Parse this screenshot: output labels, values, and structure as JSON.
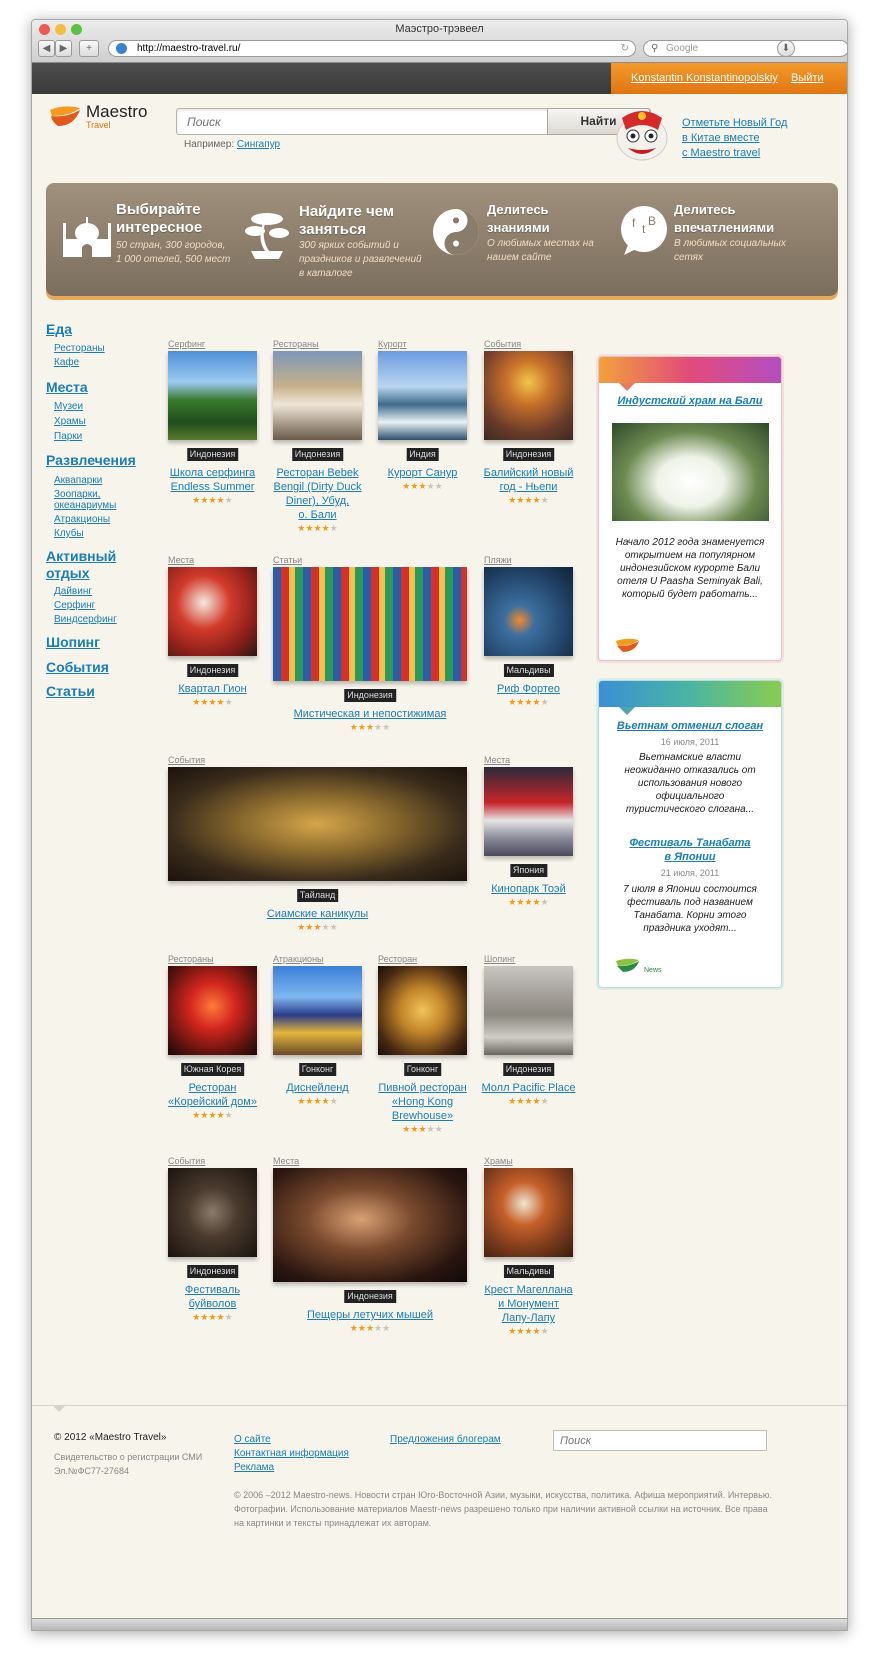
{
  "window": {
    "title": "Маэстро-трэвеел",
    "url": "http://maestro-travel.ru/",
    "search_placeholder": "Google"
  },
  "userbar": {
    "username": "Konstantin Konstantinopolskiy",
    "logout": "Выйти"
  },
  "logo": {
    "name": "Maestro",
    "sub": "Travel"
  },
  "search": {
    "placeholder": "Поиск",
    "button": "Найти",
    "example_label": "Например:",
    "example_link": "Сингапур"
  },
  "promo": {
    "line1": "Отметьте Новый Год",
    "line2": "в Китае вместе",
    "line3": "с Maestro travel"
  },
  "features": [
    {
      "title1": "Выбирайте",
      "title2": "интересное",
      "text1": "50 стран, 300 городов,",
      "text2": "1 000 отелей, 500 мест",
      "icon": "taj-mahal-icon"
    },
    {
      "title1": "Найдите чем",
      "title2": "заняться",
      "text1": "300 ярких событий и",
      "text2": "праздников и развлечений",
      "text3": "в каталоге",
      "icon": "bonsai-icon"
    },
    {
      "title1": "Делитесь",
      "title2": "знаниями",
      "text1": "О любимых местах на",
      "text2": "нашем сайте",
      "icon": "yin-yang-icon"
    },
    {
      "title1": "Делитесь",
      "title2": "впечатлениями",
      "text1": "В любимых социальных",
      "text2": "сетях",
      "icon": "social-bubble-icon"
    }
  ],
  "nav": {
    "food": "Еда",
    "food_items": [
      "Рестораны",
      "Кафе"
    ],
    "places": "Места",
    "places_items": [
      "Музеи",
      "Храмы",
      "Парки"
    ],
    "fun": "Развлечения",
    "fun_items": [
      "Аквапарки",
      "Зоопарки,",
      "океанариумы",
      "Атракционы",
      "Клубы"
    ],
    "active1": "Активный",
    "active2": "отдых",
    "active_items": [
      "Дайвинг",
      "Серфинг",
      "Виндсерфинг"
    ],
    "shopping": "Шопинг",
    "events": "События",
    "articles": "Статьи"
  },
  "items": [
    {
      "cat": "Серфинг",
      "tag": "Индонезия",
      "t1": "Школа серфинга",
      "t2": "Endless Summer",
      "rating": 4
    },
    {
      "cat": "Рестораны",
      "tag": "Индонезия",
      "t1": "Ресторан Bebek",
      "t2": "Bengil (Dirty Duck",
      "t3": "Diner), Убуд,",
      "t4": "о. Бали",
      "rating": 4
    },
    {
      "cat": "Курорт",
      "tag": "Индия",
      "t1": "Курорт Санур",
      "rating": 3
    },
    {
      "cat": "События",
      "tag": "Индонезия",
      "t1": "Балийский новый",
      "t2": "год - Ньепи",
      "rating": 4
    },
    {
      "cat": "Места",
      "tag": "Индонезия",
      "t1": "Квартал Гион",
      "rating": 4
    },
    {
      "cat": "Статьи",
      "tag": "Индонезия",
      "t1": "Мистическая и непостижимая",
      "rating": 3
    },
    {
      "cat": "Пляжи",
      "tag": "Мальдивы",
      "t1": "Риф Фортео",
      "rating": 4
    },
    {
      "cat": "События",
      "tag": "Тайланд",
      "t1": "Сиамские каникулы",
      "rating": 3
    },
    {
      "cat": "Места",
      "tag": "Япония",
      "t1": "Кинопарк Тоэй",
      "rating": 4
    },
    {
      "cat": "Рестораны",
      "tag": "Южная Корея",
      "t1": "Ресторан",
      "t2": "«Корейский дом»",
      "rating": 4
    },
    {
      "cat": "Атракционы",
      "tag": "Гонконг",
      "t1": "Диснейленд",
      "rating": 4
    },
    {
      "cat": "Ресторан",
      "tag": "Гонконг",
      "t1": "Пивной ресторан",
      "t2": "«Hong Kong",
      "t3": "Brewhouse»",
      "rating": 3
    },
    {
      "cat": "Шопинг",
      "tag": "Индонезия",
      "t1": "Молл Pacific Place",
      "rating": 4
    },
    {
      "cat": "События",
      "tag": "Индонезия",
      "t1": "Фестиваль",
      "t2": "буйволов",
      "rating": 4
    },
    {
      "cat": "Места",
      "tag": "Индонезия",
      "t1": "Пещеры летучих мышей",
      "rating": 3
    },
    {
      "cat": "Храмы",
      "tag": "Мальдивы",
      "t1": "Крест Магеллана",
      "t2": "и Монумент",
      "t3": "Лапу-Лапу",
      "rating": 4
    }
  ],
  "side_card1": {
    "title": "Индустский храм на Бали",
    "text": [
      "Начало 2012 года знаменуется",
      "открытием на популярном",
      "индонезийском курорте Бали",
      "отеля U Paasha Seminyak Bali,",
      "который будет работать..."
    ]
  },
  "side_card2": {
    "n1_title": "Вьетнам отменил слоган",
    "n1_date": "16 июля, 2011",
    "n1_text": [
      "Вьетнамские власти",
      "неожиданно отказались от",
      "использования нового",
      "официального",
      "туристического слогана..."
    ],
    "n2_title1": "Фестиваль Танабата",
    "n2_title2": "в Японии",
    "n2_date": "21 июля, 2011",
    "n2_text": [
      "7 июля в Японии состоится",
      "фестиваль под названием",
      "Танабата. Корни этого",
      "праздника уходят..."
    ],
    "news_label": "News"
  },
  "footer": {
    "copyright": "© 2012 «Maestro Travel»",
    "reg1": "Свидетельство о регистрации СМИ",
    "reg2": "Эл.№ФС77-27684",
    "about": "О сайте",
    "contacts": "Контактная информация",
    "ads": "Реклама",
    "bloggers": "Предложения блогерам",
    "search_placeholder": "Поиск",
    "legal1": "© 2006 –2012 Maestro-news. Новости стран Юго-Восточной Азии, музыки, искусства, политика. Афиша мероприятий. Интервью.",
    "legal2": "Фотографии. Использование материалов Maestr-news разрешено только при наличии активной ссылки на источник. Все права",
    "legal3": "на картинки и тексты принадлежат их авторам."
  }
}
